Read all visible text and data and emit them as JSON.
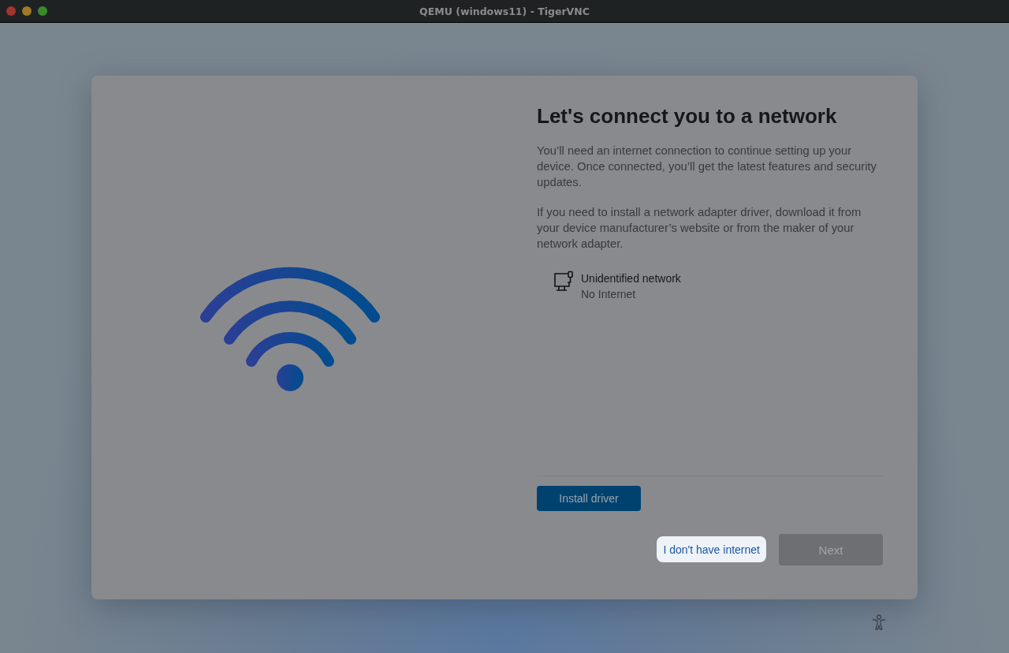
{
  "window": {
    "title": "QEMU (windows11) - TigerVNC"
  },
  "page": {
    "title": "Let's connect you to a network",
    "paragraphs": [
      "You’ll need an internet connection to continue setting up your device. Once connected, you’ll get the latest features and security updates.",
      "If you need to install a network adapter driver, download it from your device manufacturer’s website or from the maker of your network adapter."
    ],
    "network": {
      "name": "Unidentified network",
      "status": "No Internet"
    },
    "install_button": {
      "label": "Install driver"
    },
    "no_internet_link": {
      "label": "I don't have internet"
    },
    "next_button": {
      "label": "Next",
      "disabled": true
    }
  }
}
